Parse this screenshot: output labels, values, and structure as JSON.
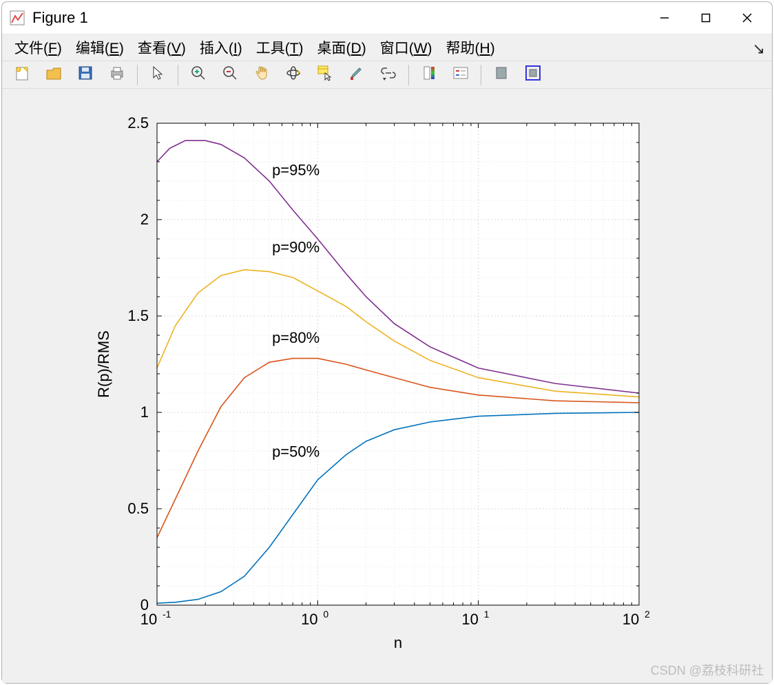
{
  "window": {
    "title": "Figure 1",
    "minimize_tooltip": "Minimize",
    "maximize_tooltip": "Maximize",
    "close_tooltip": "Close"
  },
  "menu": {
    "items": [
      {
        "label": "文件",
        "accel": "F"
      },
      {
        "label": "编辑",
        "accel": "E"
      },
      {
        "label": "查看",
        "accel": "V"
      },
      {
        "label": "插入",
        "accel": "I"
      },
      {
        "label": "工具",
        "accel": "T"
      },
      {
        "label": "桌面",
        "accel": "D"
      },
      {
        "label": "窗口",
        "accel": "W"
      },
      {
        "label": "帮助",
        "accel": "H"
      }
    ]
  },
  "toolbar": {
    "buttons": [
      "new-figure",
      "open-file",
      "save-figure",
      "print-figure",
      "|",
      "edit-pointer",
      "|",
      "zoom-in",
      "zoom-out",
      "pan",
      "rotate-3d",
      "data-cursor",
      "brush",
      "link-plots",
      "|",
      "insert-colorbar",
      "insert-legend",
      "|",
      "hide-plot-tools",
      "show-plot-tools"
    ]
  },
  "watermark": "CSDN @荔枝科研社",
  "chart_data": {
    "type": "line",
    "xlabel": "n",
    "ylabel": "R(p)/RMS",
    "xscale": "log",
    "xlim": [
      0.1,
      100
    ],
    "ylim": [
      0,
      2.5
    ],
    "xticks": [
      0.1,
      1,
      10,
      100
    ],
    "xtick_labels": [
      "10^{-1}",
      "10^{0}",
      "10^{1}",
      "10^{2}"
    ],
    "yticks": [
      0,
      0.5,
      1,
      1.5,
      2,
      2.5
    ],
    "grid": true,
    "series": [
      {
        "name": "p=50%",
        "color": "#0072BD",
        "x": [
          0.1,
          0.13,
          0.18,
          0.25,
          0.35,
          0.5,
          0.7,
          1,
          1.5,
          2,
          3,
          5,
          10,
          30,
          100
        ],
        "y": [
          0.01,
          0.015,
          0.03,
          0.07,
          0.15,
          0.3,
          0.47,
          0.65,
          0.78,
          0.85,
          0.91,
          0.95,
          0.98,
          0.995,
          1.0
        ]
      },
      {
        "name": "p=80%",
        "color": "#D95319",
        "x": [
          0.1,
          0.13,
          0.18,
          0.25,
          0.35,
          0.5,
          0.7,
          1,
          1.5,
          2,
          3,
          5,
          10,
          30,
          100
        ],
        "y": [
          0.35,
          0.55,
          0.8,
          1.03,
          1.18,
          1.26,
          1.28,
          1.28,
          1.25,
          1.22,
          1.18,
          1.13,
          1.09,
          1.06,
          1.05
        ]
      },
      {
        "name": "p=90%",
        "color": "#EDB120",
        "x": [
          0.1,
          0.13,
          0.18,
          0.25,
          0.35,
          0.5,
          0.7,
          1,
          1.5,
          2,
          3,
          5,
          10,
          30,
          100
        ],
        "y": [
          1.23,
          1.45,
          1.62,
          1.71,
          1.74,
          1.73,
          1.7,
          1.63,
          1.55,
          1.47,
          1.37,
          1.27,
          1.18,
          1.11,
          1.08
        ]
      },
      {
        "name": "p=95%",
        "color": "#7E2F8E",
        "x": [
          0.1,
          0.12,
          0.15,
          0.2,
          0.25,
          0.35,
          0.5,
          0.7,
          1,
          1.5,
          2,
          3,
          5,
          10,
          30,
          100
        ],
        "y": [
          2.3,
          2.37,
          2.41,
          2.41,
          2.39,
          2.32,
          2.2,
          2.05,
          1.9,
          1.72,
          1.6,
          1.46,
          1.34,
          1.23,
          1.15,
          1.1
        ]
      }
    ],
    "annotations": [
      {
        "text": "p=95%",
        "x": 0.52,
        "y": 2.23
      },
      {
        "text": "p=90%",
        "x": 0.52,
        "y": 1.83
      },
      {
        "text": "p=80%",
        "x": 0.52,
        "y": 1.36
      },
      {
        "text": "p=50%",
        "x": 0.52,
        "y": 0.77
      }
    ]
  }
}
